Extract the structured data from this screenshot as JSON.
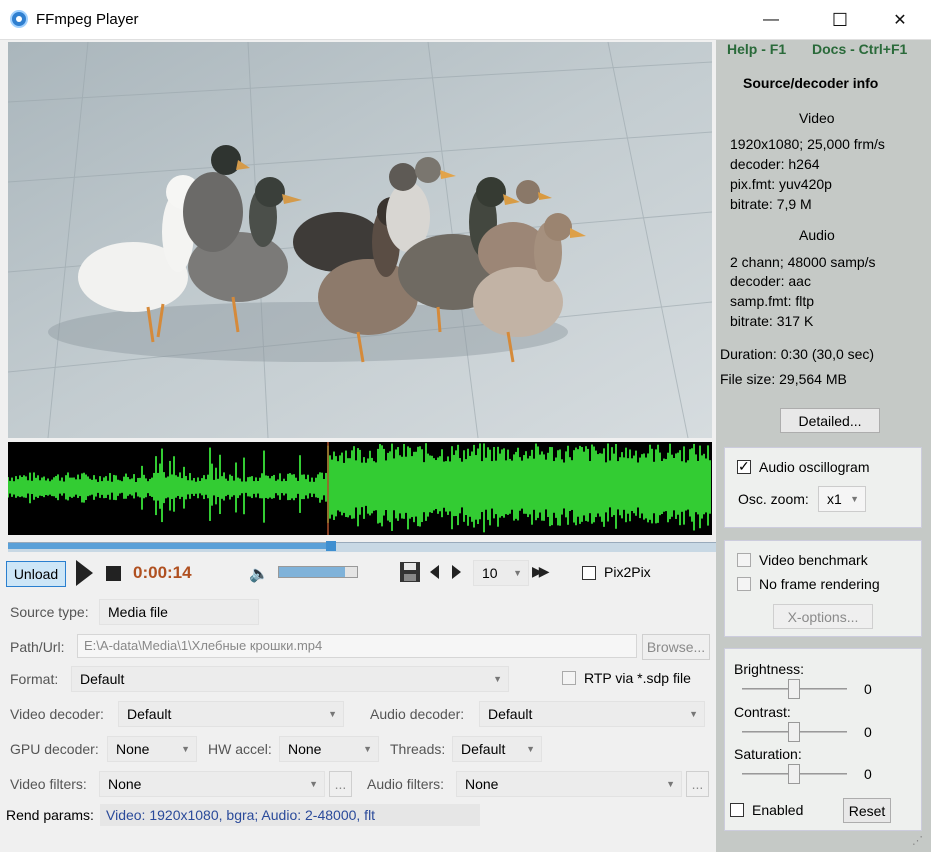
{
  "window": {
    "title": "FFmpeg Player",
    "minimize_glyph": "—",
    "maximize_glyph": "☐",
    "close_glyph": "✕"
  },
  "header_links": {
    "help": "Help - F1",
    "docs": "Docs - Ctrl+F1"
  },
  "source_info": {
    "heading": "Source/decoder info",
    "video_heading": "Video",
    "video_lines": [
      "1920x1080; 25,000 frm/s",
      "decoder: h264",
      "pix.fmt: yuv420p",
      "bitrate: 7,9 M"
    ],
    "audio_heading": "Audio",
    "audio_lines": [
      "2 chann; 48000 samp/s",
      "decoder: aac",
      "samp.fmt: fltp",
      "bitrate: 317 K"
    ],
    "duration": "Duration: 0:30 (30,0 sec)",
    "file_size": "File size: 29,564 MB",
    "detailed_button": "Detailed..."
  },
  "oscillogram_panel": {
    "audio_oscillogram_label": "Audio oscillogram",
    "audio_oscillogram_checked": true,
    "osc_zoom_label": "Osc. zoom:",
    "osc_zoom_value": "x1"
  },
  "benchmark_panel": {
    "video_benchmark_label": "Video benchmark",
    "no_frame_rendering_label": "No frame rendering",
    "x_options_button": "X-options..."
  },
  "picture_panel": {
    "brightness_label": "Brightness:",
    "brightness_value": "0",
    "contrast_label": "Contrast:",
    "contrast_value": "0",
    "saturation_label": "Saturation:",
    "saturation_value": "0",
    "enabled_label": "Enabled",
    "reset_button": "Reset"
  },
  "transport": {
    "unload_button": "Unload",
    "time": "0:00:14",
    "seek_position": 0.46,
    "volume_level": 0.85,
    "step_value": "10",
    "pix2pix_label": "Pix2Pix"
  },
  "form": {
    "source_type_label": "Source type:",
    "source_type_value": "Media file",
    "path_label": "Path/Url:",
    "path_value": "E:\\A-data\\Media\\1\\Хлебные крошки.mp4",
    "browse_button": "Browse...",
    "format_label": "Format:",
    "format_value": "Default",
    "rtp_label": "RTP via *.sdp file",
    "video_decoder_label": "Video decoder:",
    "video_decoder_value": "Default",
    "audio_decoder_label": "Audio decoder:",
    "audio_decoder_value": "Default",
    "gpu_decoder_label": "GPU decoder:",
    "gpu_decoder_value": "None",
    "hw_accel_label": "HW accel:",
    "hw_accel_value": "None",
    "threads_label": "Threads:",
    "threads_value": "Default",
    "video_filters_label": "Video filters:",
    "video_filters_value": "None",
    "audio_filters_label": "Audio filters:",
    "audio_filters_value": "None",
    "ellipsis": "...",
    "rend_params_label": "Rend params:",
    "rend_params_value": "Video: 1920x1080, bgra; Audio: 2-48000, flt"
  },
  "colors": {
    "oscillogram_wave": "#33cc33",
    "time_text": "#b05020",
    "right_panel_bg": "#c5c9c6",
    "help_links": "#2a6a3a",
    "rend_params_text": "#2a4a9a"
  }
}
